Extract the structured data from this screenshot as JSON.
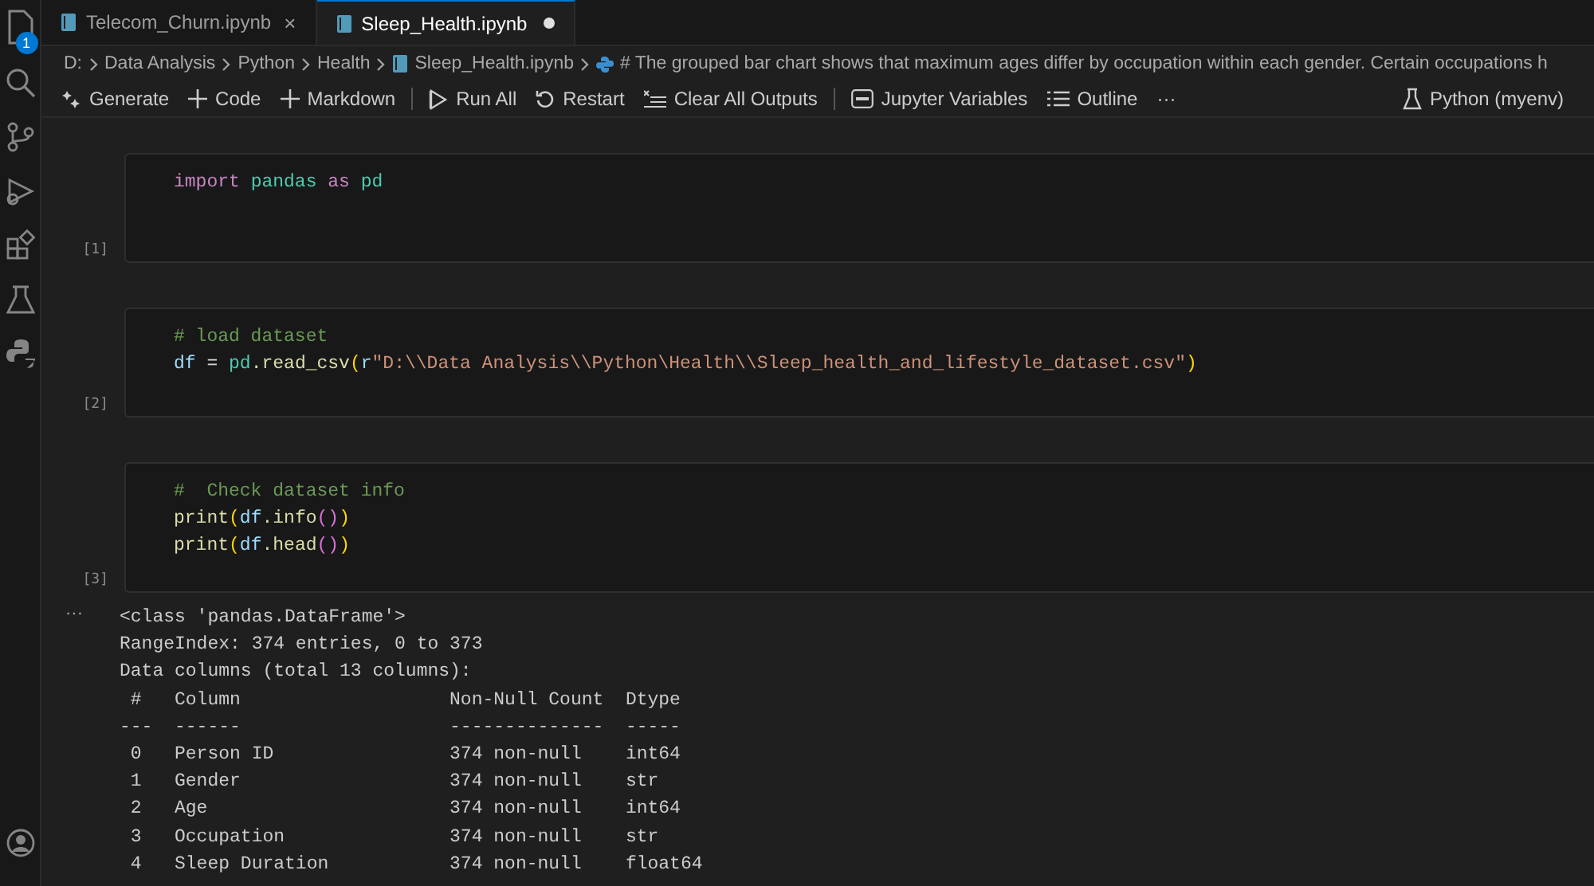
{
  "activity_bar": {
    "explorer_badge": "1"
  },
  "tabs": [
    {
      "label": "Telecom_Churn.ipynb",
      "selected": false,
      "dirty": false,
      "close": "×"
    },
    {
      "label": "Sleep_Health.ipynb",
      "selected": true,
      "dirty": true
    }
  ],
  "breadcrumbs": [
    {
      "kind": "text",
      "label": "D:"
    },
    {
      "kind": "text",
      "label": "Data Analysis"
    },
    {
      "kind": "text",
      "label": "Python"
    },
    {
      "kind": "text",
      "label": "Health"
    },
    {
      "kind": "notebook",
      "label": "Sleep_Health.ipynb"
    },
    {
      "kind": "cell",
      "label": "# The grouped bar chart shows that maximum ages differ by occupation within each gender. Certain occupations h"
    }
  ],
  "toolbar": {
    "left": [
      {
        "kind": "sparkle",
        "label": "Generate"
      },
      {
        "kind": "plus",
        "label": "Code"
      },
      {
        "kind": "plus",
        "label": "Markdown"
      },
      {
        "kind": "divider"
      },
      {
        "kind": "run",
        "label": "Run All"
      },
      {
        "kind": "restart",
        "label": "Restart"
      },
      {
        "kind": "clear",
        "label": "Clear All Outputs"
      },
      {
        "kind": "divider"
      },
      {
        "kind": "variables",
        "label": "Jupyter Variables"
      },
      {
        "kind": "outline",
        "label": "Outline"
      },
      {
        "kind": "more",
        "label": "···"
      }
    ],
    "kernel": "Python (myenv)"
  },
  "cells": [
    {
      "count": "[1]",
      "lines": [
        [
          {
            "text": "import ",
            "kind": "keyword"
          },
          {
            "text": "pandas ",
            "kind": "module"
          },
          {
            "text": "as ",
            "kind": "keyword"
          },
          {
            "text": "pd",
            "kind": "module"
          }
        ]
      ]
    },
    {
      "count": "[2]",
      "lines": [
        [
          {
            "text": "# load dataset",
            "kind": "comment"
          }
        ],
        [
          {
            "text": "df",
            "kind": "variable"
          },
          {
            "text": " = ",
            "kind": "plain"
          },
          {
            "text": "pd",
            "kind": "module"
          },
          {
            "text": ".read_csv",
            "kind": "function"
          },
          {
            "text": "(",
            "kind": "paren"
          },
          {
            "text": "r",
            "kind": "variable"
          },
          {
            "text": "\"D:\\\\Data Analysis\\\\Python\\Health\\\\Sleep_health_and_lifestyle_dataset.csv\"",
            "kind": "string"
          },
          {
            "text": ")",
            "kind": "paren"
          }
        ]
      ]
    },
    {
      "count": "[3]",
      "lines": [
        [
          {
            "text": "#  Check dataset info",
            "kind": "comment"
          }
        ],
        [
          {
            "text": "print",
            "kind": "function"
          },
          {
            "text": "(",
            "kind": "paren"
          },
          {
            "text": "df",
            "kind": "variable"
          },
          {
            "text": ".info",
            "kind": "function"
          },
          {
            "text": "()",
            "kind": "paren2"
          },
          {
            "text": ")",
            "kind": "paren"
          }
        ],
        [
          {
            "text": "print",
            "kind": "function"
          },
          {
            "text": "(",
            "kind": "paren"
          },
          {
            "text": "df",
            "kind": "variable"
          },
          {
            "text": ".head",
            "kind": "function"
          },
          {
            "text": "()",
            "kind": "paren2"
          },
          {
            "text": ")",
            "kind": "paren"
          }
        ]
      ]
    }
  ],
  "output": {
    "marker": "···",
    "lines": [
      "<class 'pandas.DataFrame'>",
      "RangeIndex: 374 entries, 0 to 373",
      "Data columns (total 13 columns):",
      " #   Column                   Non-Null Count  Dtype  ",
      "---  ------                   --------------  -----  ",
      " 0   Person ID                374 non-null    int64  ",
      " 1   Gender                   374 non-null    str    ",
      " 2   Age                      374 non-null    int64  ",
      " 3   Occupation               374 non-null    str    ",
      " 4   Sleep Duration           374 non-null    float64"
    ]
  }
}
